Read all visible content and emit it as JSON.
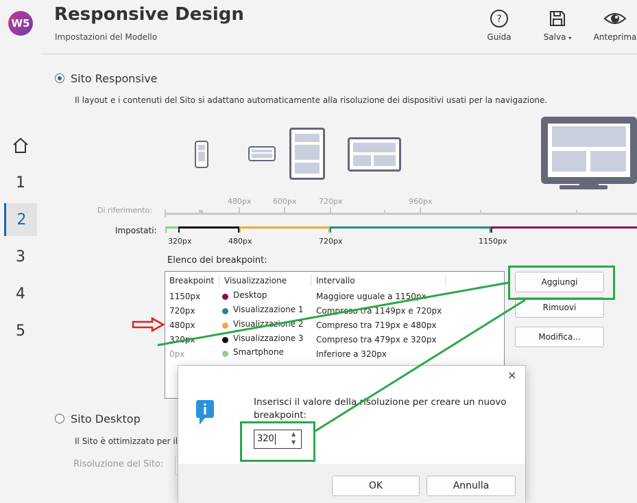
{
  "app": {
    "logo_text": "W5",
    "title": "Responsive Design",
    "subtitle": "Impostazioni del Modello"
  },
  "toolbar": {
    "guida": "Guida",
    "salva": "Salva",
    "anteprima": "Anteprima"
  },
  "nav": {
    "steps": [
      "1",
      "2",
      "3",
      "4",
      "5"
    ],
    "active": "2"
  },
  "responsive": {
    "label": "Sito Responsive",
    "selected": true,
    "description": "Il layout e i contenuti del Sito si adattano automaticamente alla risoluzione dei dispositivi usati per la navigazione."
  },
  "reference_scale": {
    "label": "Di riferimento:",
    "ticks": [
      "480px",
      "600px",
      "720px",
      "960px"
    ]
  },
  "set_scale": {
    "label": "Impostati:",
    "ticks": [
      "320px",
      "480px",
      "720px",
      "1150px"
    ]
  },
  "breakpoint_list": {
    "title": "Elenco dei breakpoint:",
    "columns": [
      "Breakpoint",
      "Visualizzazione",
      "Intervallo"
    ],
    "rows": [
      {
        "breakpoint": "1150px",
        "view": "Desktop",
        "range": "Maggiore uguale a 1150px",
        "color": "#8b0f4b"
      },
      {
        "breakpoint": "720px",
        "view": "Visualizzazione 1",
        "range": "Compreso tra 1149px e 720px",
        "color": "#1e8c86"
      },
      {
        "breakpoint": "480px",
        "view": "Visualizzazione 2",
        "range": "Compreso tra 719px e 480px",
        "color": "#f0a83c"
      },
      {
        "breakpoint": "320px",
        "view": "Visualizzazione 3",
        "range": "Compreso tra 479px e 320px",
        "color": "#111111"
      },
      {
        "breakpoint": "0px",
        "view": "Smartphone",
        "range": "Inferiore a 320px",
        "color": "#8fd08f"
      }
    ]
  },
  "buttons": {
    "add": "Aggiungi",
    "remove": "Rimuovi",
    "edit": "Modifica..."
  },
  "desktop": {
    "label": "Sito Desktop",
    "selected": false,
    "description": "Il Sito è ottimizzato per il l",
    "resolution_label": "Risoluzione del Sito:"
  },
  "dialog": {
    "message": "Inserisci il valore della risoluzione per creare un nuovo breakpoint:",
    "value": "320",
    "ok": "OK",
    "cancel": "Annulla",
    "close": "×"
  },
  "colors": {
    "accent": "#1a6aa8",
    "highlight": "#2aa84a",
    "arrow": "#e02020"
  }
}
